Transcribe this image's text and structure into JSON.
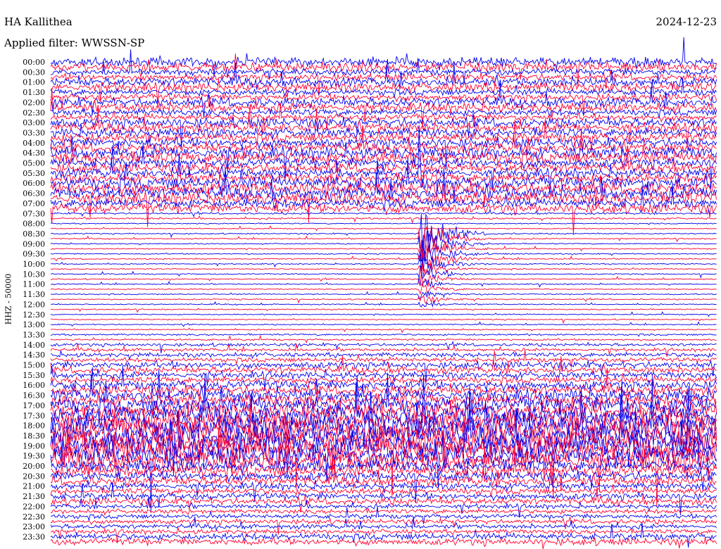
{
  "header": {
    "station": "HA Kallithea",
    "date": "2024-12-23",
    "filter": "Applied filter: WWSSN-SP"
  },
  "chart_data": {
    "type": "line",
    "ylabel": "HHZ - 50000",
    "row_labels": [
      "00:00",
      "00:30",
      "01:00",
      "01:30",
      "02:00",
      "02:30",
      "03:00",
      "03:30",
      "04:00",
      "04:30",
      "05:00",
      "05:30",
      "06:00",
      "06:30",
      "07:00",
      "07:30",
      "08:00",
      "08:30",
      "09:00",
      "09:30",
      "10:00",
      "10:30",
      "11:00",
      "11:30",
      "12:00",
      "12:30",
      "13:00",
      "13:30",
      "14:00",
      "14:30",
      "15:00",
      "15:30",
      "16:00",
      "16:30",
      "17:00",
      "17:30",
      "18:00",
      "18:30",
      "19:00",
      "19:30",
      "20:00",
      "20:30",
      "21:00",
      "21:30",
      "22:00",
      "22:30",
      "23:00",
      "23:30"
    ],
    "series_colors": [
      "#0000ee",
      "#ff0033"
    ],
    "activity_by_row": [
      6,
      5,
      6,
      5,
      6,
      5,
      6,
      6,
      6,
      7,
      6,
      6,
      7,
      7,
      6,
      2,
      1,
      1,
      1,
      1,
      1,
      1,
      1,
      1,
      1,
      1,
      1,
      2,
      3,
      4,
      5,
      5,
      6,
      7,
      8,
      9,
      10,
      10,
      10,
      9,
      7,
      6,
      5,
      5,
      4,
      4,
      4,
      5
    ],
    "large_event": {
      "time": "08:00",
      "trace_index": 2,
      "x_fraction": 0.557
    }
  }
}
